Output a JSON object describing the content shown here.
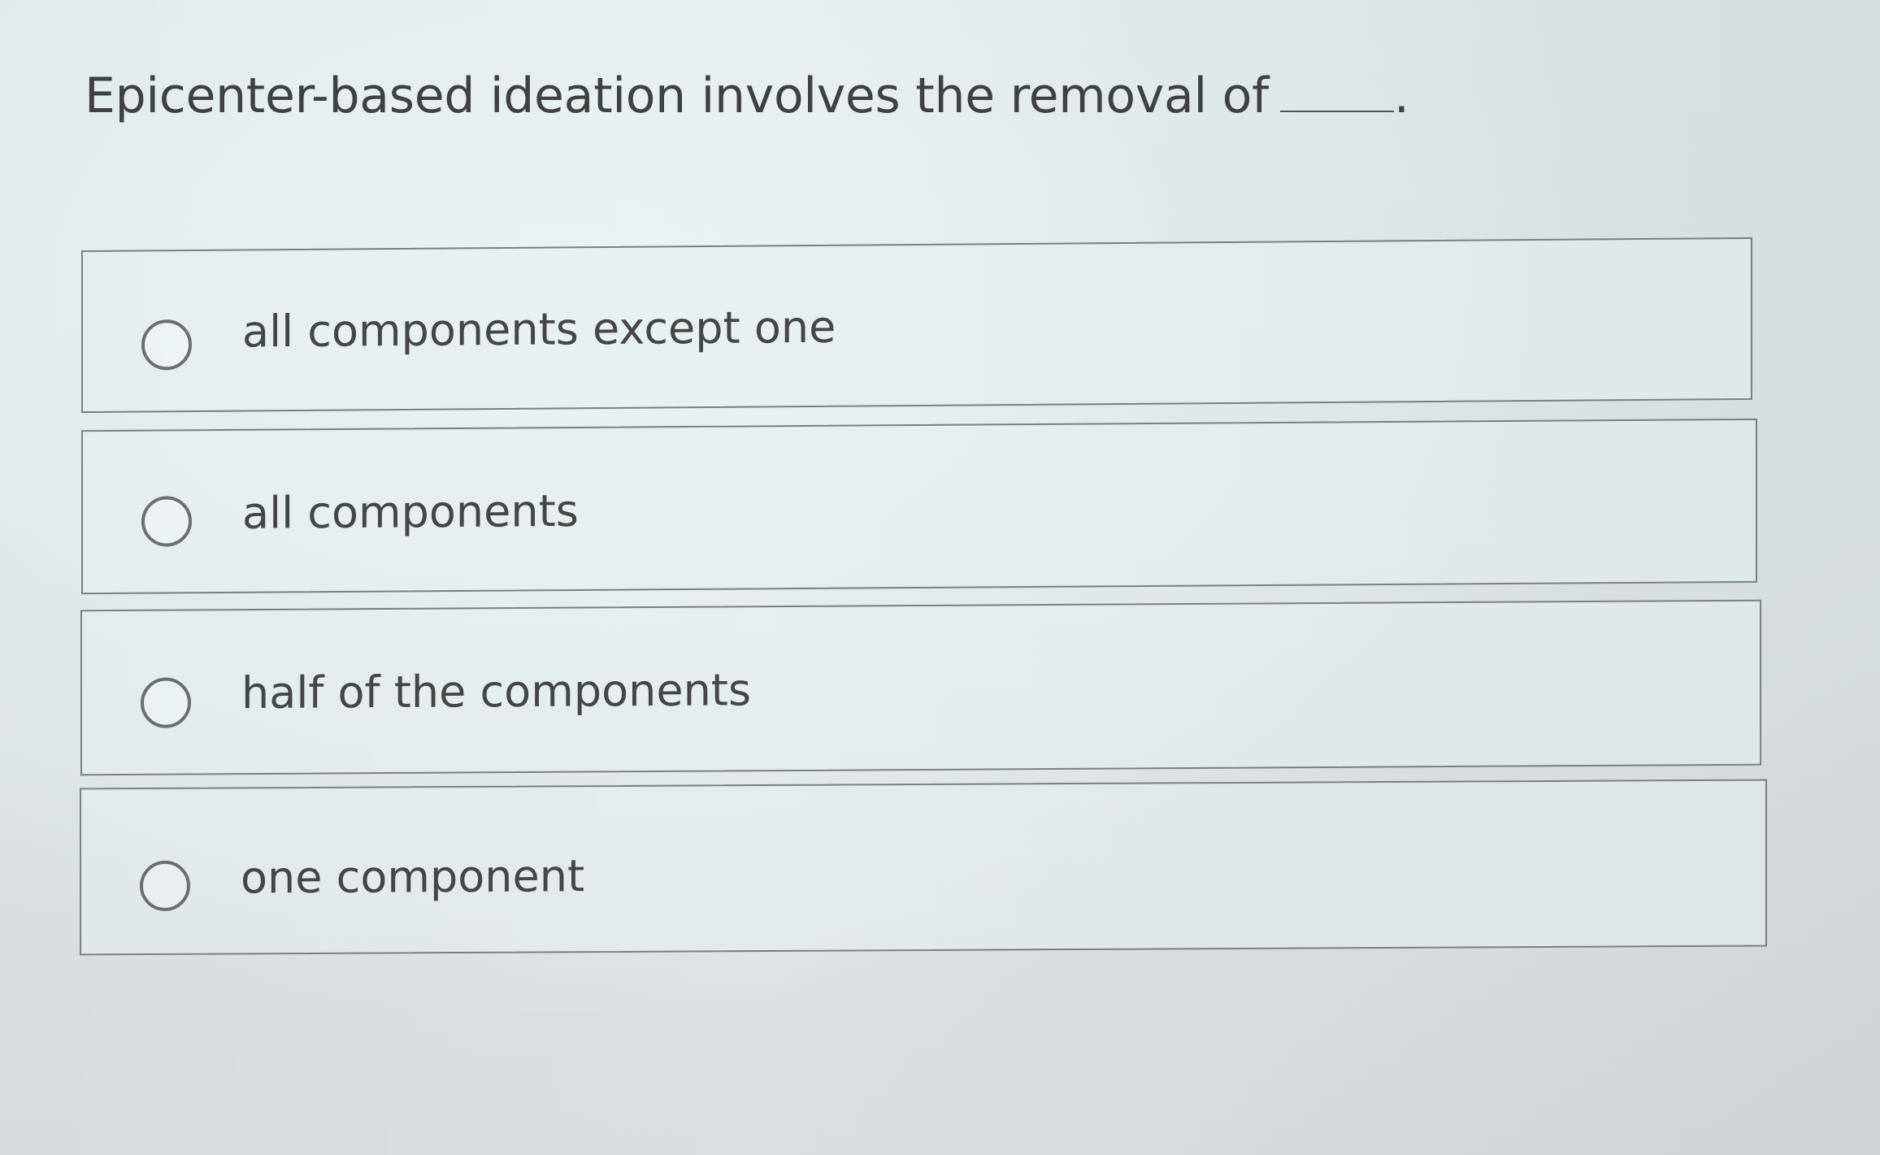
{
  "question": {
    "text": "Epicenter-based ideation involves the removal of",
    "blank_suffix": "."
  },
  "options": [
    {
      "label": "all components except one",
      "selected": false
    },
    {
      "label": "all components",
      "selected": false
    },
    {
      "label": "half of the components",
      "selected": false
    },
    {
      "label": "one component",
      "selected": false
    }
  ]
}
